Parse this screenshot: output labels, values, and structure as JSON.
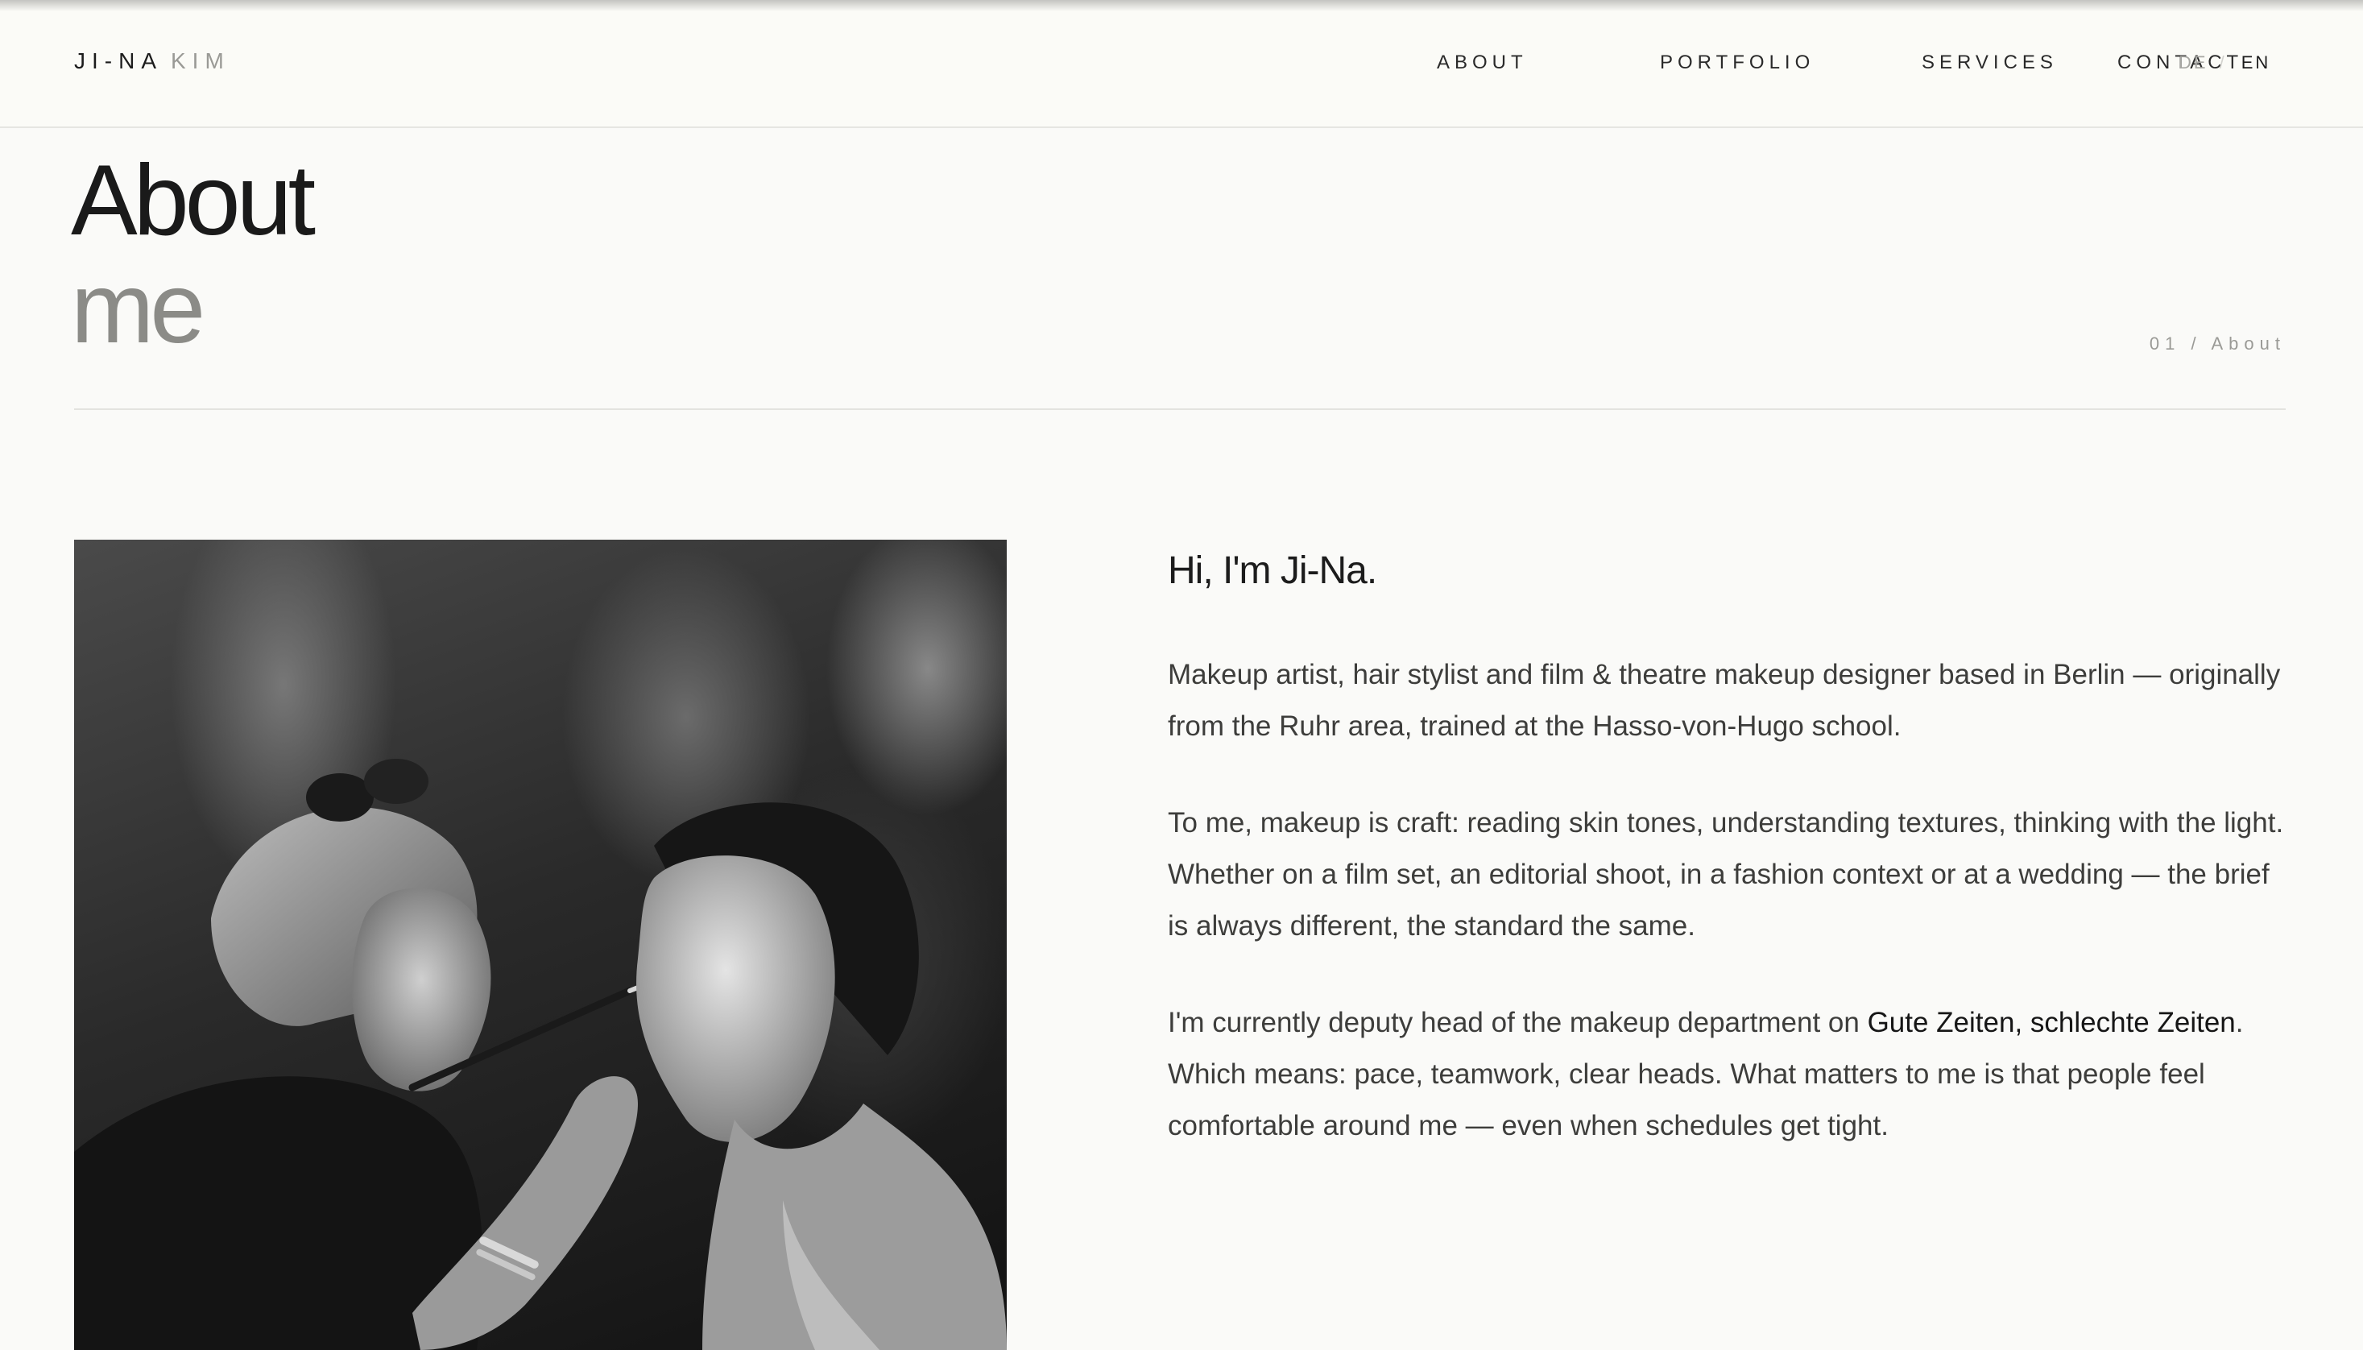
{
  "header": {
    "logo_first": "JI-NA",
    "logo_last": "KIM",
    "nav": [
      "ABOUT",
      "PORTFOLIO",
      "SERVICES",
      "CONTACT"
    ],
    "lang_de": "DE",
    "lang_sep": "/",
    "lang_en": "EN"
  },
  "hero": {
    "title_line1": "About",
    "title_line2": "me",
    "crumb": "01 / About"
  },
  "bio": {
    "heading": "Hi, I'm Ji-Na.",
    "p1": "Makeup artist, hair stylist and film & theatre makeup designer based in Berlin — originally from the Ruhr area, trained at the Hasso-von-Hugo school.",
    "p2": "To me, makeup is craft: reading skin tones, understanding textures, thinking with the light. Whether on a film set, an editorial shoot, in a fashion context or at a wedding — the brief is always different, the standard the same.",
    "p3_before": "I'm currently deputy head of the makeup department on ",
    "p3_show": "Gute Zeiten, schlechte Zeiten",
    "p3_after": ". Which means: pace, teamwork, clear heads. What matters to me is that people feel comfortable around me — even when schedules get tight."
  },
  "colors": {
    "background": "#fafaf8",
    "text": "#1c1c1c",
    "muted": "#8b8b87"
  }
}
